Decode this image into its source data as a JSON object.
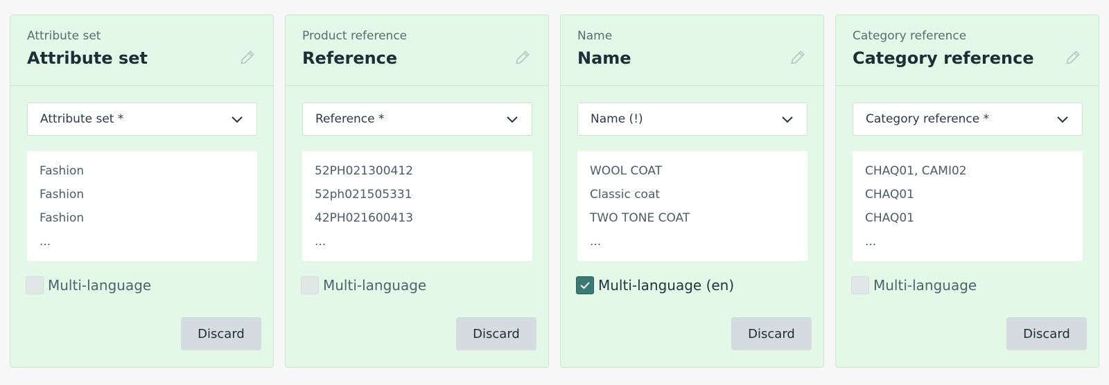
{
  "cards": [
    {
      "subtitle": "Attribute set",
      "title": "Attribute set",
      "select_value": "Attribute set *",
      "values": [
        "Fashion",
        "Fashion",
        "Fashion",
        "..."
      ],
      "checkbox_label": "Multi-language",
      "checkbox_checked": false,
      "discard_label": "Discard"
    },
    {
      "subtitle": "Product reference",
      "title": "Reference",
      "select_value": "Reference *",
      "values": [
        "52PH021300412",
        "52ph021505331",
        "42PH021600413",
        "..."
      ],
      "checkbox_label": "Multi-language",
      "checkbox_checked": false,
      "discard_label": "Discard"
    },
    {
      "subtitle": "Name",
      "title": "Name",
      "select_value": "Name (!)",
      "values": [
        "WOOL COAT",
        "Classic coat",
        "TWO TONE COAT",
        "..."
      ],
      "checkbox_label": "Multi-language (en)",
      "checkbox_checked": true,
      "discard_label": "Discard"
    },
    {
      "subtitle": "Category reference",
      "title": "Category reference",
      "select_value": "Category reference *",
      "values": [
        "CHAQ01, CAMI02",
        "CHAQ01",
        "CHAQ01",
        "..."
      ],
      "checkbox_label": "Multi-language",
      "checkbox_checked": false,
      "discard_label": "Discard"
    }
  ],
  "icons": {
    "edit": "pencil-icon",
    "dropdown": "chevron-down-icon",
    "check": "check-icon"
  },
  "colors": {
    "card_bg": "#e3f8e6",
    "card_border": "#cde8d1",
    "checkbox_on": "#3b7a74",
    "button_bg": "#d4dcdf"
  }
}
